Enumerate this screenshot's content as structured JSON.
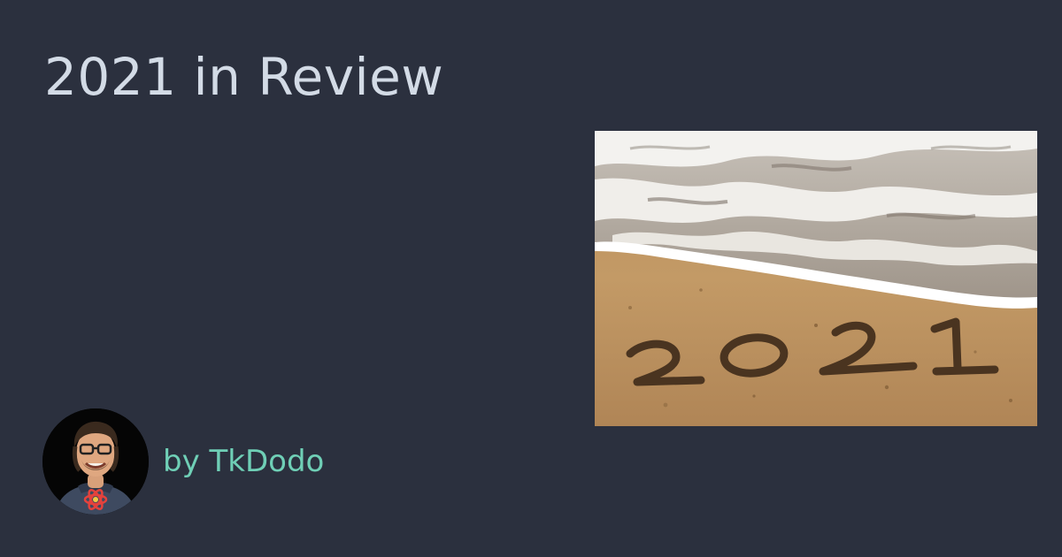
{
  "page": {
    "title": "2021 in Review",
    "byline": "by TkDodo"
  },
  "hero_image": {
    "subject": "beach-sand-writing",
    "sand_text": "2021"
  },
  "avatar": {
    "subject": "author-photo"
  },
  "colors": {
    "background": "#2b303e",
    "title": "#d3dbe6",
    "byline": "#6fcfb6"
  }
}
